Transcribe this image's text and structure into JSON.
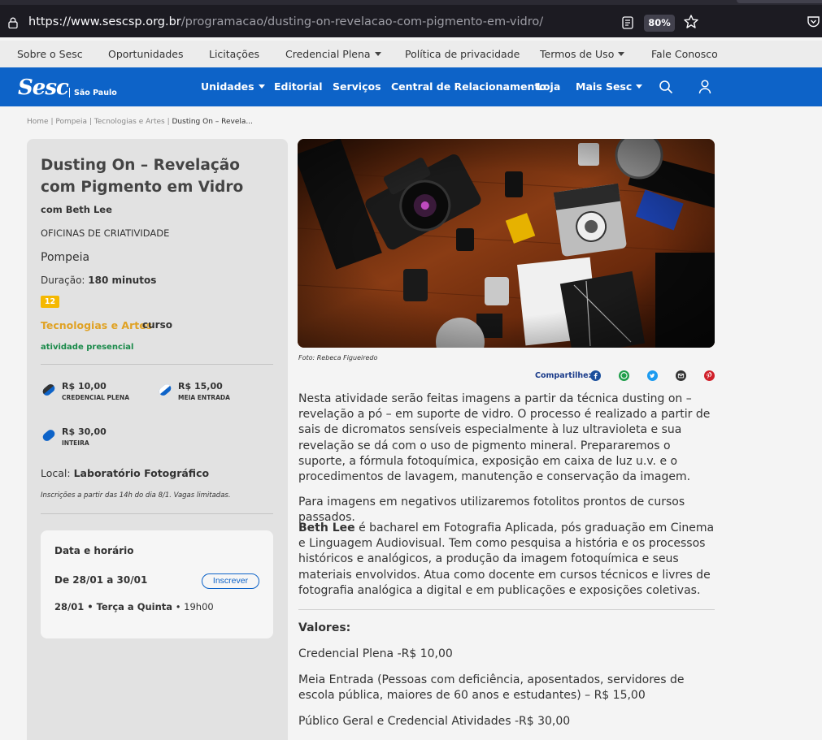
{
  "browser": {
    "url_host": "https://www.sescsp.org.br",
    "url_path": "/programacao/dusting-on-revelacao-com-pigmento-em-vidro/",
    "zoom": "80%"
  },
  "topnav": {
    "items": [
      "Sobre o Sesc",
      "Oportunidades",
      "Licitações",
      "Credencial Plena",
      "Política de privacidade",
      "Termos de Uso",
      "Fale Conosco"
    ]
  },
  "mainnav": {
    "logo": "Sesc",
    "logo_sub": "São Paulo",
    "items": [
      "Unidades",
      "Editorial",
      "Serviços",
      "Central de Relacionamento",
      "Loja",
      "Mais Sesc"
    ]
  },
  "breadcrumb": {
    "items": [
      "Home",
      "Pompeia",
      "Tecnologias e Artes"
    ],
    "current": "Dusting On – Revela..."
  },
  "event": {
    "title": "Dusting On – Revelação com Pigmento em Vidro",
    "host": "com Beth Lee",
    "category": "OFICINAS DE CRIATIVIDADE",
    "unit": "Pompeia",
    "duration_label": "Duração:",
    "duration_value": "180 minutos",
    "age": "12",
    "theme": "Tecnologias e Artes",
    "type": "curso",
    "mode": "atividade presencial",
    "prices": [
      {
        "value": "R$ 10,00",
        "label": "CREDENCIAL PLENA"
      },
      {
        "value": "R$ 15,00",
        "label": "MEIA ENTRADA"
      },
      {
        "value": "R$ 30,00",
        "label": "INTEIRA"
      }
    ],
    "local_label": "Local:",
    "local_value": "Laboratório Fotográfico",
    "note": "Inscrições a partir das 14h do dia 8/1. Vagas limitadas."
  },
  "schedule": {
    "heading": "Data e horário",
    "range": "De 28/01 a 30/01",
    "button": "Inscrever",
    "days": "28/01 • Terça a Quinta",
    "time": "• 19h00"
  },
  "hero": {
    "caption": "Foto: Rebeca Figueiredo"
  },
  "share": {
    "label": "Compartilhe:",
    "colors": {
      "facebook": "#1b4f9c",
      "whatsapp": "#1f9e4a",
      "twitter": "#1d9bf0",
      "email": "#333333",
      "pinterest": "#d0202a"
    }
  },
  "content": {
    "p1": "Nesta atividade serão feitas imagens a partir da técnica dusting on – revelação a pó – em suporte de vidro. O processo é realizado a partir de sais de dicromatos sensíveis especialmente à luz ultravioleta e sua revelação se dá com o uso de pigmento mineral. Prepararemos o suporte, a fórmula fotoquímica, exposição em caixa de luz u.v. e o procedimentos de lavagem, manutenção e conservação da imagem.",
    "p2": "Para imagens em negativos utilizaremos fotolitos prontos de cursos passados.",
    "p3_name": "Beth Lee",
    "p3_rest": " é bacharel em Fotografia Aplicada, pós graduação em Cinema e Linguagem Audiovisual. Tem como pesquisa a história e os processos históricos e analógicos, a produção da imagem fotoquímica e seus materiais envolvidos. Atua como docente em cursos técnicos e livres de fotografia analógica a digital e em publicações e exposições coletivas.",
    "values_heading": "Valores:",
    "v1": "Credencial Plena -R$ 10,00",
    "v2": "Meia Entrada (Pessoas com deficiência, aposentados, servidores de escola pública, maiores de 60 anos e estudantes) –  R$ 15,00",
    "v3": "Público Geral e Credencial Atividades -R$ 30,00"
  },
  "colors": {
    "brand_blue": "#0d63c8",
    "theme_gold": "#e0a224",
    "age_badge": "#f5b800",
    "presencial_green": "#1a8a4a"
  }
}
